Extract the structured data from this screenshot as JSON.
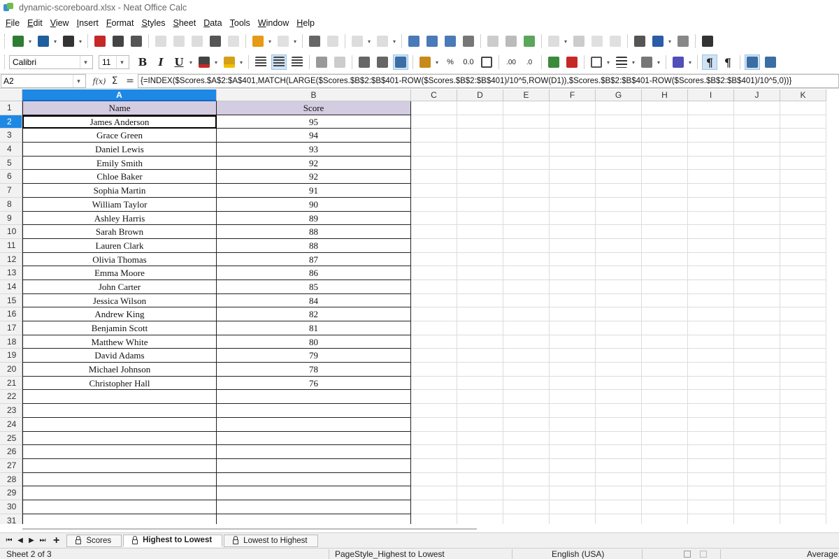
{
  "window": {
    "title": "dynamic-scoreboard.xlsx - Neat Office Calc"
  },
  "menu": [
    "File",
    "Edit",
    "View",
    "Insert",
    "Format",
    "Styles",
    "Sheet",
    "Data",
    "Tools",
    "Window",
    "Help"
  ],
  "toolbar2": {
    "font_name": "Calibri",
    "font_size": "11",
    "bold": "B",
    "italic": "I",
    "underline": "U",
    "percent": "%",
    "decimal": "0.0",
    "add_decimal": ".00",
    "remove_decimal": ".0"
  },
  "formula_bar": {
    "cell_ref": "A2",
    "fx_label": "f(x)",
    "sum_label": "Σ",
    "equals_label": "=",
    "formula": "{=INDEX($Scores.$A$2:$A$401,MATCH(LARGE($Scores.$B$2:$B$401-ROW($Scores.$B$2:$B$401)/10^5,ROW(D1)),$Scores.$B$2:$B$401-ROW($Scores.$B$2:$B$401)/10^5,0))}"
  },
  "grid": {
    "columns": [
      "A",
      "B",
      "C",
      "D",
      "E",
      "F",
      "G",
      "H",
      "I",
      "J",
      "K"
    ],
    "rows": [
      "1",
      "2",
      "3",
      "4",
      "5",
      "6",
      "7",
      "8",
      "9",
      "10",
      "11",
      "12",
      "13",
      "14",
      "15",
      "16",
      "17",
      "18",
      "19",
      "20",
      "21",
      "22",
      "23",
      "24",
      "25",
      "26",
      "27",
      "28",
      "29",
      "30",
      "31"
    ],
    "headers": [
      "Name",
      "Score"
    ],
    "data": [
      [
        "James Anderson",
        "95"
      ],
      [
        "Grace Green",
        "94"
      ],
      [
        "Daniel Lewis",
        "93"
      ],
      [
        "Emily Smith",
        "92"
      ],
      [
        "Chloe Baker",
        "92"
      ],
      [
        "Sophia Martin",
        "91"
      ],
      [
        "William Taylor",
        "90"
      ],
      [
        "Ashley Harris",
        "89"
      ],
      [
        "Sarah Brown",
        "88"
      ],
      [
        "Lauren Clark",
        "88"
      ],
      [
        "Olivia Thomas",
        "87"
      ],
      [
        "Emma Moore",
        "86"
      ],
      [
        "John Carter",
        "85"
      ],
      [
        "Jessica Wilson",
        "84"
      ],
      [
        "Andrew King",
        "82"
      ],
      [
        "Benjamin Scott",
        "81"
      ],
      [
        "Matthew White",
        "80"
      ],
      [
        "David Adams",
        "79"
      ],
      [
        "Michael Johnson",
        "78"
      ],
      [
        "Christopher Hall",
        "76"
      ]
    ],
    "selected_cell": "A2",
    "header_fill": "#d4cce1",
    "selection_color": "#1e88e5"
  },
  "sheets": {
    "tabs": [
      "Scores",
      "Highest to Lowest",
      "Lowest to Highest"
    ],
    "active": "Highest to Lowest"
  },
  "status": {
    "sheet_info": "Sheet 2 of 3",
    "page_style": "PageStyle_Highest to Lowest",
    "language": "English (USA)",
    "summary": "Average:"
  }
}
